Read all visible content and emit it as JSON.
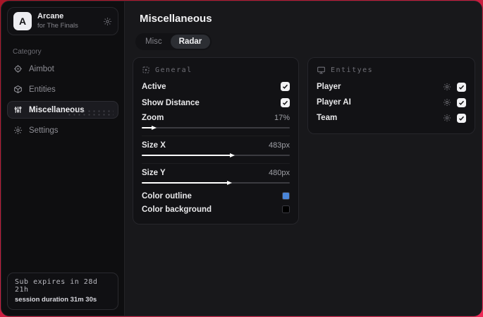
{
  "sidebar": {
    "brand": {
      "initial": "A",
      "name": "Arcane",
      "subtitle": "for The Finals"
    },
    "category_label": "Category",
    "items": [
      {
        "label": "Aimbot",
        "icon": "crosshair-icon",
        "active": false
      },
      {
        "label": "Entities",
        "icon": "cube-icon",
        "active": false
      },
      {
        "label": "Miscellaneous",
        "icon": "sliders-icon",
        "active": true
      },
      {
        "label": "Settings",
        "icon": "gear-icon",
        "active": false
      }
    ],
    "subscription": {
      "expiry": "Sub expires in 28d 21h",
      "session": "session duration 31m 30s"
    }
  },
  "main": {
    "title": "Miscellaneous",
    "tabs": [
      {
        "label": "Misc",
        "active": false
      },
      {
        "label": "Radar",
        "active": true
      }
    ]
  },
  "panels": {
    "general": {
      "title": "General",
      "icon": "grid-icon",
      "toggles": [
        {
          "label": "Active",
          "checked": true
        },
        {
          "label": "Show Distance",
          "checked": true
        }
      ],
      "sliders": [
        {
          "label": "Zoom",
          "value": "17%",
          "percent": 7
        },
        {
          "label": "Size X",
          "value": "483px",
          "percent": 60
        },
        {
          "label": "Size Y",
          "value": "480px",
          "percent": 58
        }
      ],
      "colors": [
        {
          "label": "Color outline",
          "swatch": "#4a86d9"
        },
        {
          "label": "Color background",
          "swatch": "#000000"
        }
      ]
    },
    "entities": {
      "title": "Entityes",
      "icon": "monitor-icon",
      "rows": [
        {
          "label": "Player",
          "checked": true
        },
        {
          "label": "Player AI",
          "checked": true
        },
        {
          "label": "Team",
          "checked": true
        }
      ]
    }
  },
  "theme": {
    "accent_red": "#c71d3e",
    "swatch_blue": "#4a86d9"
  }
}
